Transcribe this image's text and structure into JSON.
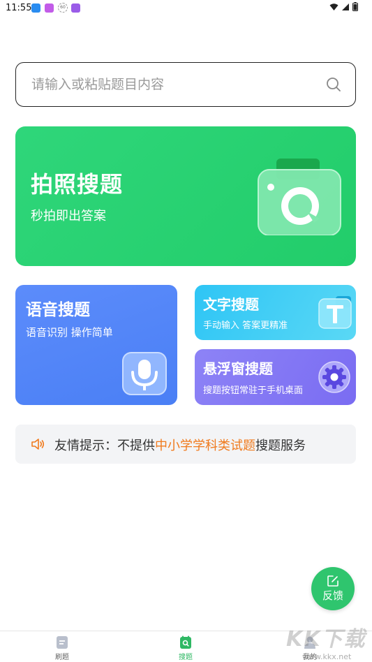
{
  "status_bar": {
    "time": "11:55",
    "badge_text": "60"
  },
  "search": {
    "placeholder": "请输入或粘贴题目内容"
  },
  "photo_search": {
    "title": "拍照搜题",
    "subtitle": "秒拍即出答案"
  },
  "voice_search": {
    "title": "语音搜题",
    "subtitle": "语音识别 操作简单"
  },
  "text_search": {
    "title": "文字搜题",
    "subtitle": "手动输入 答案更精准"
  },
  "float_search": {
    "title": "悬浮窗搜题",
    "subtitle": "搜题按钮常驻于手机桌面"
  },
  "tip": {
    "prefix": "友情提示：不提供",
    "highlight": "中小学学科类试题",
    "suffix": "搜题服务",
    "highlight_color": "#f07a1d"
  },
  "feedback": {
    "label": "反馈"
  },
  "bottom_nav": {
    "items": [
      {
        "label": "刷题",
        "icon": "document-icon"
      },
      {
        "label": "搜题",
        "icon": "search-tab-icon",
        "active": true
      },
      {
        "label": "我的",
        "icon": "user-icon"
      }
    ]
  },
  "watermark": {
    "logo": "KK下载",
    "url": "www.kkx.net"
  },
  "colors": {
    "green": "#22cd6a",
    "blue": "#4a7ff5",
    "cyan": "#2ec5f5",
    "purple": "#7a6cf2"
  }
}
